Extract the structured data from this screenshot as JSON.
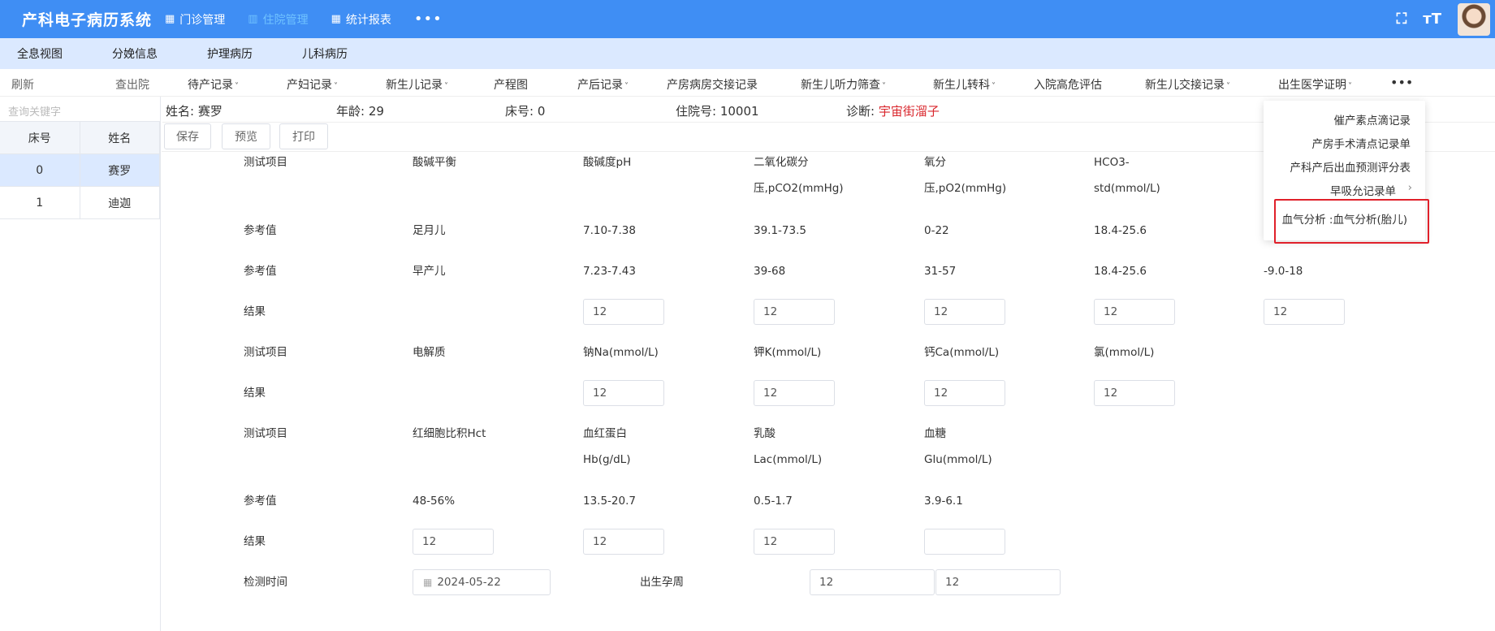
{
  "app": {
    "title": "产科电子病历系统",
    "nav": [
      {
        "label": "门诊管理",
        "icon": "table-grid-icon"
      },
      {
        "label": "住院管理",
        "icon": "bar-chart-icon"
      },
      {
        "label": "统计报表",
        "icon": "table-grid-icon"
      }
    ],
    "more": "•••",
    "colors": {
      "header": "#3f8ef4",
      "subnav": "#dbe9ff",
      "accent_text": "#d9262c",
      "highlight_box": "#e0202a"
    }
  },
  "subnav": [
    "全息视图",
    "分娩信息",
    "护理病历",
    "儿科病历"
  ],
  "toolbar": {
    "refresh": "刷新",
    "discharge": "查出院",
    "items": [
      "待产记录",
      "产妇记录",
      "新生儿记录",
      "产程图",
      "产后记录",
      "产房病房交接记录",
      "新生儿听力筛查",
      "新生儿转科",
      "入院高危评估",
      "新生儿交接记录",
      "出生医学证明"
    ],
    "more": "•••"
  },
  "left": {
    "search_placeholder": "查询关键字",
    "headers": [
      "床号",
      "姓名"
    ],
    "rows": [
      {
        "bed": "0",
        "name": "赛罗"
      },
      {
        "bed": "1",
        "name": "迪迦"
      }
    ]
  },
  "patient": {
    "name_label": "姓名:",
    "name": "赛罗",
    "age_label": "年龄:",
    "age": "29",
    "bed_label": "床号:",
    "bed": "0",
    "admission_label": "住院号:",
    "admission": "10001",
    "diagnosis_label": "诊断:",
    "diagnosis": "宇宙街溜子"
  },
  "actions": {
    "save": "保存",
    "preview": "预览",
    "print": "打印"
  },
  "form": {
    "label_test": "测试项目",
    "label_ref": "参考值",
    "label_result": "结果",
    "acid_base": "酸碱平衡",
    "ph": "酸碱度pH",
    "pco2_a": "二氧化碳分",
    "pco2_b": "压,pCO2(mmHg)",
    "po2_a": "氧分",
    "po2_b": "压,pO2(mmHg)",
    "hco3_a": "HCO3-",
    "hco3_b": "std(mmol/L)",
    "full_term": "足月儿",
    "ref1": [
      "7.10-7.38",
      "39.1-73.5",
      "0-22",
      "18.4-25.6"
    ],
    "preterm": "早产儿",
    "ref2": [
      "7.23-7.43",
      "39-68",
      "31-57",
      "18.4-25.6",
      "-9.0-18"
    ],
    "result1": [
      "12",
      "12",
      "12",
      "12",
      "12"
    ],
    "electrolytes": "电解质",
    "na": "钠Na(mmol/L)",
    "k": "钾K(mmol/L)",
    "ca": "钙Ca(mmol/L)",
    "cl": "氯(mmol/L)",
    "result2": [
      "12",
      "12",
      "12",
      "12"
    ],
    "hct": "红细胞比积Hct",
    "hb_a": "血红蛋白",
    "hb_b": "Hb(g/dL)",
    "lac_a": "乳酸",
    "lac_b": "Lac(mmol/L)",
    "glu_a": "血糖",
    "glu_b": "Glu(mmol/L)",
    "ref3": [
      "48-56%",
      "13.5-20.7",
      "0.5-1.7",
      "3.9-6.1"
    ],
    "result3": [
      "12",
      "12",
      "12",
      ""
    ],
    "test_time_label": "检测时间",
    "test_time": "2024-05-22",
    "gest_label": "出生孕周",
    "gest_week": "12",
    "gest_day": "12"
  },
  "dropdown": {
    "items": [
      "催产素点滴记录",
      "产房手术清点记录单",
      "产科产后出血预测评分表",
      "早吸允记录单"
    ],
    "highlighted": "血气分析 :血气分析(胎儿)"
  }
}
